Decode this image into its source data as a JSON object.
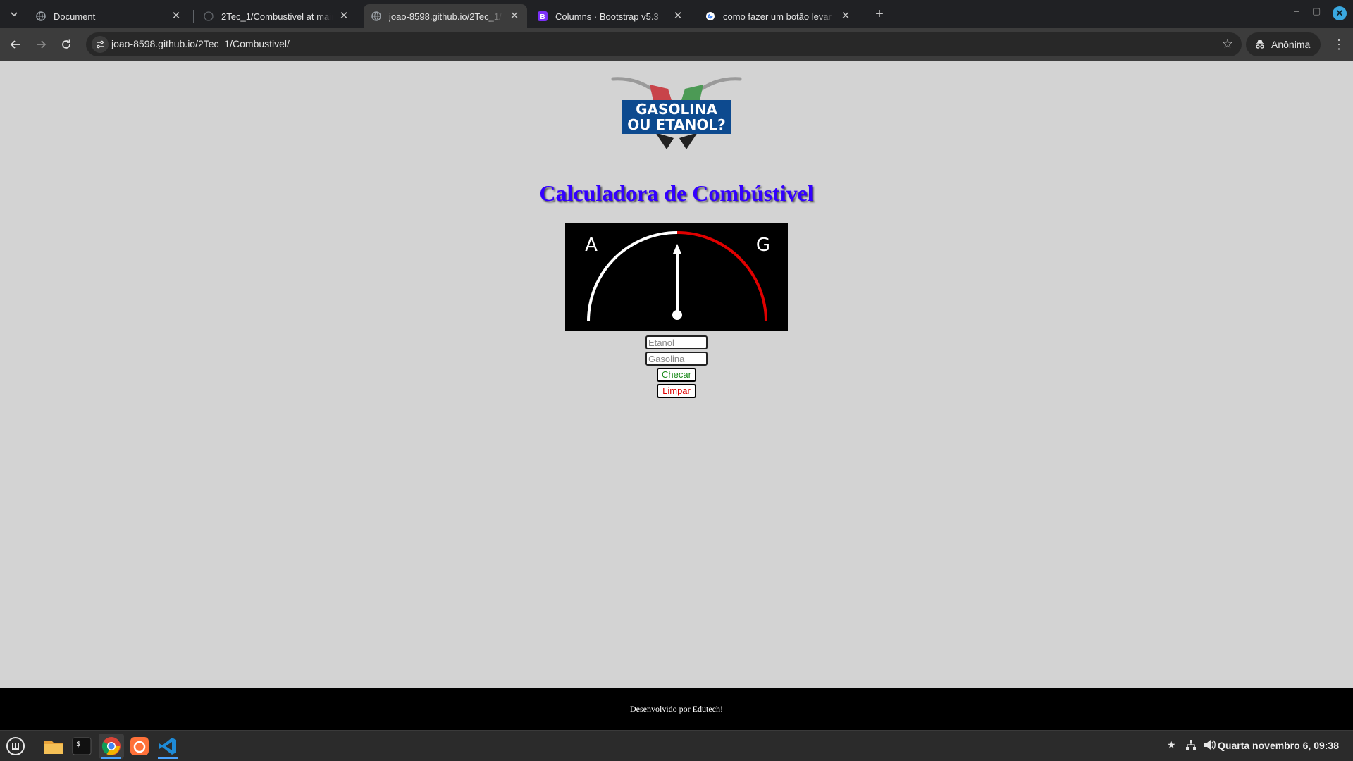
{
  "browser": {
    "tabs": [
      {
        "title": "Document",
        "icon": "globe-icon"
      },
      {
        "title": "2Tec_1/Combustivel at main",
        "icon": "github-icon"
      },
      {
        "title": "joao-8598.github.io/2Tec_1/",
        "icon": "globe-icon"
      },
      {
        "title": "Columns · Bootstrap v5.3",
        "icon": "bootstrap-icon"
      },
      {
        "title": "como fazer um botão levar p",
        "icon": "google-icon"
      }
    ],
    "url": "joao-8598.github.io/2Tec_1/Combustivel/",
    "incognito_label": "Anônima"
  },
  "page": {
    "logo": {
      "line1": "GASOLINA",
      "line2": "OU ETANOL?"
    },
    "title": "Calculadora de Combústivel",
    "gauge": {
      "left_label": "A",
      "right_label": "G",
      "needle_position": 0.5
    },
    "inputs": {
      "etanol_placeholder": "Etanol",
      "gasolina_placeholder": "Gasolina"
    },
    "buttons": {
      "check": "Checar",
      "clear": "Limpar"
    },
    "footer": "Desenvolvido por Edutech!"
  },
  "taskbar": {
    "apps": [
      "menu-icon",
      "files-icon",
      "terminal-icon",
      "chrome-icon",
      "firefox-icon",
      "vscode-icon"
    ],
    "clock": "Quarta novembro  6, 09:38"
  },
  "colors": {
    "title": "#3300ff",
    "gauge_bg": "#000000",
    "gauge_arc_left": "#ffffff",
    "gauge_arc_right": "#e00000",
    "check_text": "#1a8a1a",
    "clear_text": "#e00000",
    "page_bg": "#d3d3d3"
  }
}
